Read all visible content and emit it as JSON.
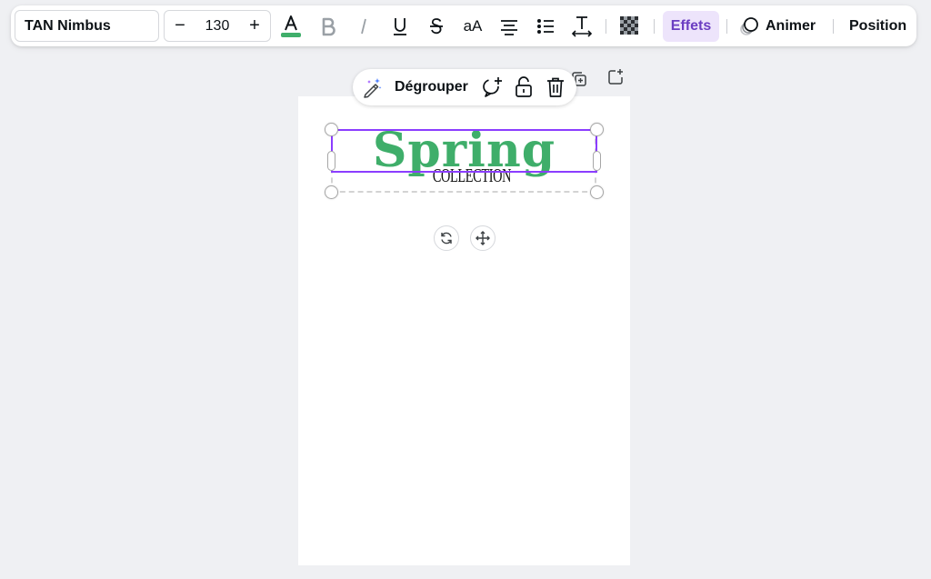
{
  "toolbar": {
    "font_name": "TAN Nimbus",
    "font_size": "130",
    "decrease_label": "−",
    "increase_label": "+",
    "text_color": "#3fae6a",
    "case_label": "aA",
    "effets_label": "Effets",
    "animer_label": "Animer",
    "position_label": "Position",
    "icons": [
      "text-color-icon",
      "bold-icon",
      "italic-icon",
      "underline-icon",
      "strikethrough-icon",
      "letter-case-icon",
      "align-center-icon",
      "list-icon",
      "spacing-icon",
      "transparency-icon",
      "animate-icon"
    ]
  },
  "context_toolbar": {
    "ungroup_label": "Dégrouper",
    "icons": [
      "magic-edit-icon",
      "comment-add-icon",
      "lock-icon",
      "trash-icon"
    ]
  },
  "canvas": {
    "title_text": "Spring",
    "subtitle_text": "COLLECTION",
    "title_color": "#3fae6a",
    "selection_color": "#8b3dff"
  },
  "page_tools": [
    "duplicate-page-icon",
    "add-page-icon"
  ],
  "group_controls": [
    "rotate-icon",
    "move-icon"
  ]
}
